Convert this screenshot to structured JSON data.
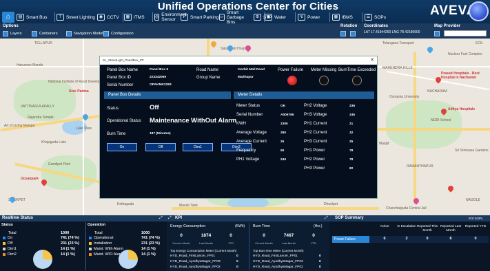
{
  "header": {
    "title": "Unified Operations Center for Cities",
    "logo": "AVEVA",
    "tabs": [
      {
        "label": "Smart Bus",
        "icon": "bus-icon"
      },
      {
        "label": "Street Lighting",
        "icon": "streetlight-icon"
      },
      {
        "label": "CCTV",
        "icon": "camera-icon"
      },
      {
        "label": "ITMS",
        "icon": "traffic-icon"
      },
      {
        "label": "Environment Sensor",
        "icon": "sensor-icon"
      },
      {
        "label": "Smart Parking",
        "icon": "parking-icon"
      },
      {
        "label": "Smart Garbage Bins",
        "icon": "bin-icon"
      },
      {
        "label": "STP",
        "icon": "stp-icon"
      },
      {
        "label": "Water",
        "icon": "water-icon"
      },
      {
        "label": "Power",
        "icon": "power-icon"
      },
      {
        "label": "IBMS",
        "icon": "building-icon"
      },
      {
        "label": "SOPs",
        "icon": "sop-icon"
      }
    ]
  },
  "toolbar": {
    "options_label": "Options",
    "layers": "Layers",
    "containers": "Containers",
    "navigation_model": "Navigation Model",
    "configuration": "Configuration",
    "rotation_label": "Rotation",
    "coordinates_label": "Coordinates",
    "coordinates": "LAT 17.41944260  LNG 78.42189600",
    "map_provider_label": "Map Provider"
  },
  "map": {
    "labels": [
      "TELLAPUR",
      "Hanuman Mandir",
      "National Institute of Rural Development",
      "VATTINAGULAPALLY",
      "Sree Padma",
      "Rajendra Temple",
      "Art of Living Mangal",
      "Lake View",
      "Khajaguda Lake",
      "Gandipet Park",
      "Oceanpark",
      "SHAIKPET",
      "Dhoolpet",
      "Chanchalguda Central Jail",
      "RAMANTHAPUR",
      "NAGOLE",
      "Prasad Hospitals - Best Hospital in Nacharam",
      "Aditya Hospitals",
      "NGRI School",
      "Telangana Transport",
      "Nuclear Fuel Complex",
      "Osmania University",
      "NACHARAM",
      "Sri Srinivasa Gardens",
      "Masjid",
      "Sabarmati Hospital",
      "Masab Tank",
      "Kothaguda",
      "MAHENDRA HILLS",
      "ECIL"
    ]
  },
  "popup": {
    "window_title": "SL_StreetLight_PanelBox_PF",
    "panel_box_name_label": "Panel Box Name",
    "panel_box_name": "Panel Box 5",
    "panel_box_id_label": "Panel Box ID",
    "panel_box_id": "223342069",
    "serial_number_label": "Serial Number",
    "serial_number": "OPAKMK2283",
    "road_name_label": "Road Name",
    "road_name": "Inorbit Mall Road",
    "group_name_label": "Group Name",
    "group_name": "Madhapur",
    "power_failure_label": "Power Failure",
    "meter_missing_label": "Meter Missing",
    "burntime_exceeded_label": "BurnTime Exceeded",
    "panel_box_details_label": "Panel Box Details",
    "meter_details_label": "Meter Details",
    "status_label": "Status",
    "status_value": "Off",
    "operational_status_label": "Operational Status",
    "operational_status_value": "Maintenance WithOut Alarm",
    "burn_time_label": "Burn Time",
    "burn_time_value": "187 (Minutes)",
    "buttons": [
      "On",
      "Off",
      "Dim1",
      "Dim2"
    ],
    "meter_rows": [
      {
        "label": "Meter Status",
        "value": "OK"
      },
      {
        "label": "Serial Number",
        "value": "A009785"
      },
      {
        "label": "KWH",
        "value": "2300"
      },
      {
        "label": "Average Voltage",
        "value": "280"
      },
      {
        "label": "Average Current",
        "value": "25"
      },
      {
        "label": "Frequency",
        "value": "50"
      },
      {
        "label": "PH1 Voltage",
        "value": "240"
      }
    ],
    "phase_rows": [
      {
        "label": "PH2 Voltage",
        "value": "236"
      },
      {
        "label": "PH3 Voltage",
        "value": "245"
      },
      {
        "label": "PH1 Current",
        "value": "21"
      },
      {
        "label": "PH2 Current",
        "value": "32"
      },
      {
        "label": "PH3 Current",
        "value": "25"
      },
      {
        "label": "PH1 Power",
        "value": "78"
      },
      {
        "label": "PH2 Power",
        "value": "78"
      },
      {
        "label": "PH3 Power",
        "value": "82"
      }
    ]
  },
  "realtime": {
    "title": "Realtime Status",
    "status": {
      "title": "Status",
      "total_label": "Total",
      "total_value": "1000",
      "rows": [
        {
          "label": "On",
          "value": "741 (74 %)",
          "color": "#1e8cff"
        },
        {
          "label": "Off",
          "value": "231 (23 %)",
          "color": "#f2c22e"
        },
        {
          "label": "Dim1",
          "value": "14 (1 %)",
          "color": "#d9d9d9"
        },
        {
          "label": "Dim2",
          "value": "14 (1 %)",
          "color": "#f08a2a"
        }
      ]
    },
    "operation": {
      "title": "Operation",
      "total_label": "Total",
      "total_value": "1000",
      "rows": [
        {
          "label": "Operational",
          "value": "741 (74 %)",
          "color": "#1e8cff"
        },
        {
          "label": "Installation",
          "value": "231 (23 %)",
          "color": "#f2c22e"
        },
        {
          "label": "Maint. With Alarm",
          "value": "14 (1 %)",
          "color": "#d9d9d9"
        },
        {
          "label": "Maint. W/O Alarm",
          "value": "14 (1 %)",
          "color": "#f08a2a"
        }
      ]
    }
  },
  "kpi": {
    "title": "KPI",
    "energy": {
      "title": "Energy Consumption",
      "unit": "(KWh)",
      "values": [
        "0",
        "1874",
        "0"
      ],
      "subs": [
        "Current Month",
        "Last Month",
        "YTD"
      ],
      "top_title": "Top Energy Consumption Meter (Current Month)",
      "top_rows": [
        {
          "name": "HYD_Road_FirstLancer_FP01",
          "value": "0"
        },
        {
          "name": "HYD_Road_AyodhyaNagar_FP03",
          "value": "0"
        },
        {
          "name": "HYD_Road_AyodhyaNagar_FP02",
          "value": "0"
        }
      ]
    },
    "burn": {
      "title": "Burn Time",
      "unit": "(Hrs.)",
      "values": [
        "0",
        "7467",
        "0"
      ],
      "subs": [
        "Current Month",
        "Last Month",
        "YTD"
      ],
      "top_title": "Top Burn time Meter (Current Month)",
      "top_rows": [
        {
          "name": "HYD_Road_FirstLancer_FP01",
          "value": "0"
        },
        {
          "name": "HYD_Road_AyodhyaNagar_FP03",
          "value": "0"
        },
        {
          "name": "HYD_Road_AyodhyaNagar_FP02",
          "value": "0"
        }
      ]
    }
  },
  "sop": {
    "title": "SOP Summary",
    "count_label": "#Of SOPs",
    "columns": [
      "Active",
      "In Escalation",
      "Reported This Month",
      "Reported Last Month",
      "Reported YTD"
    ],
    "row_label": "Power Failure",
    "row_values": [
      "6",
      "2",
      "0",
      "6",
      "0"
    ]
  }
}
